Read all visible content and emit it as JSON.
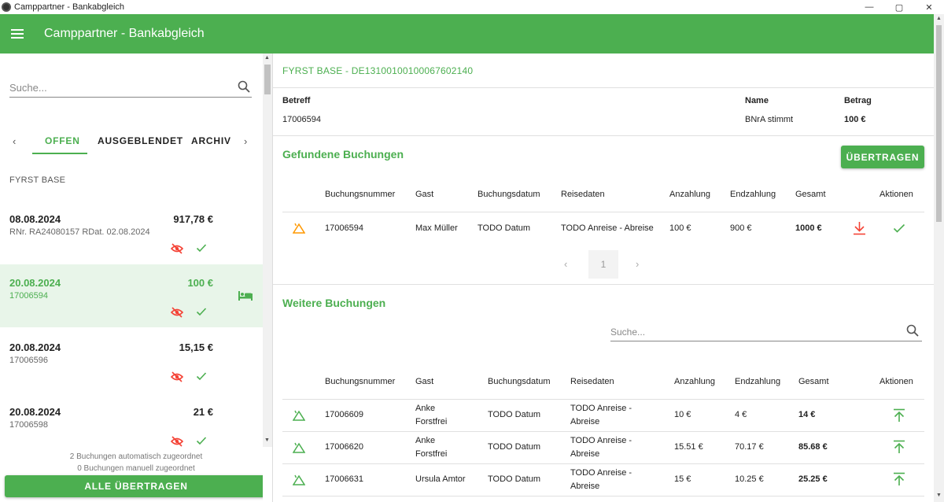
{
  "window": {
    "title": "Camppartner - Bankabgleich",
    "minimize": "—",
    "maximize": "▢",
    "close": "✕"
  },
  "appbar": {
    "title": "Camppartner - Bankabgleich"
  },
  "left": {
    "search_placeholder": "Suche...",
    "tabs": [
      "OFFEN",
      "AUSGEBLENDET",
      "ARCHIV"
    ],
    "group": "FYRST BASE",
    "items": [
      {
        "date": "08.08.2024",
        "amount": "917,78 €",
        "sub": "RNr. RA24080157 RDat. 02.08.2024"
      },
      {
        "date": "20.08.2024",
        "amount": "100 €",
        "sub": "17006594"
      },
      {
        "date": "20.08.2024",
        "amount": "15,15 €",
        "sub": "17006596"
      },
      {
        "date": "20.08.2024",
        "amount": "21 €",
        "sub": "17006598"
      }
    ],
    "info_auto": "2 Buchungen automatisch zugeordnet",
    "info_manual": "0 Buchungen manuell zugeordnet",
    "all_button": "ALLE ÜBERTRAGEN"
  },
  "detail": {
    "account": "FYRST BASE - DE13100100100067602140",
    "labels": {
      "betreff": "Betreff",
      "name": "Name",
      "betrag": "Betrag"
    },
    "values": {
      "betreff": "17006594",
      "name": "BNrA stimmt",
      "betrag": "100 €"
    }
  },
  "found": {
    "title": "Gefundene Buchungen",
    "button": "ÜBERTRAGEN",
    "headers": [
      "Buchungsnummer",
      "Gast",
      "Buchungsdatum",
      "Reisedaten",
      "Anzahlung",
      "Endzahlung",
      "Gesamt",
      "Aktionen"
    ],
    "rows": [
      {
        "nr": "17006594",
        "gast": "Max Müller",
        "datum": "TODO Datum",
        "reise": "TODO Anreise - Abreise",
        "anz": "100 €",
        "end": "900 €",
        "ges": "1000 €"
      }
    ],
    "page": "1"
  },
  "more": {
    "title": "Weitere Buchungen",
    "search_placeholder": "Suche...",
    "headers": [
      "Buchungsnummer",
      "Gast",
      "Buchungsdatum",
      "Reisedaten",
      "Anzahlung",
      "Endzahlung",
      "Gesamt",
      "Aktionen"
    ],
    "rows": [
      {
        "nr": "17006609",
        "gast1": "Anke",
        "gast2": "Forstfrei",
        "datum": "TODO Datum",
        "reise1": "TODO Anreise -",
        "reise2": "Abreise",
        "anz": "10 €",
        "end": "4 €",
        "ges": "14 €"
      },
      {
        "nr": "17006620",
        "gast1": "Anke",
        "gast2": "Forstfrei",
        "datum": "TODO Datum",
        "reise1": "TODO Anreise -",
        "reise2": "Abreise",
        "anz": "15.51 €",
        "end": "70.17 €",
        "ges": "85.68 €"
      },
      {
        "nr": "17006631",
        "gast1": "Ursula Amtor",
        "gast2": "",
        "datum": "TODO Datum",
        "reise1": "TODO Anreise -",
        "reise2": "Abreise",
        "anz": "15 €",
        "end": "10.25 €",
        "ges": "25.25 €"
      }
    ]
  },
  "colors": {
    "primary": "#4caf50",
    "danger": "#f44336",
    "warning": "#ff9800",
    "selected_bg": "#e8f5e9"
  }
}
